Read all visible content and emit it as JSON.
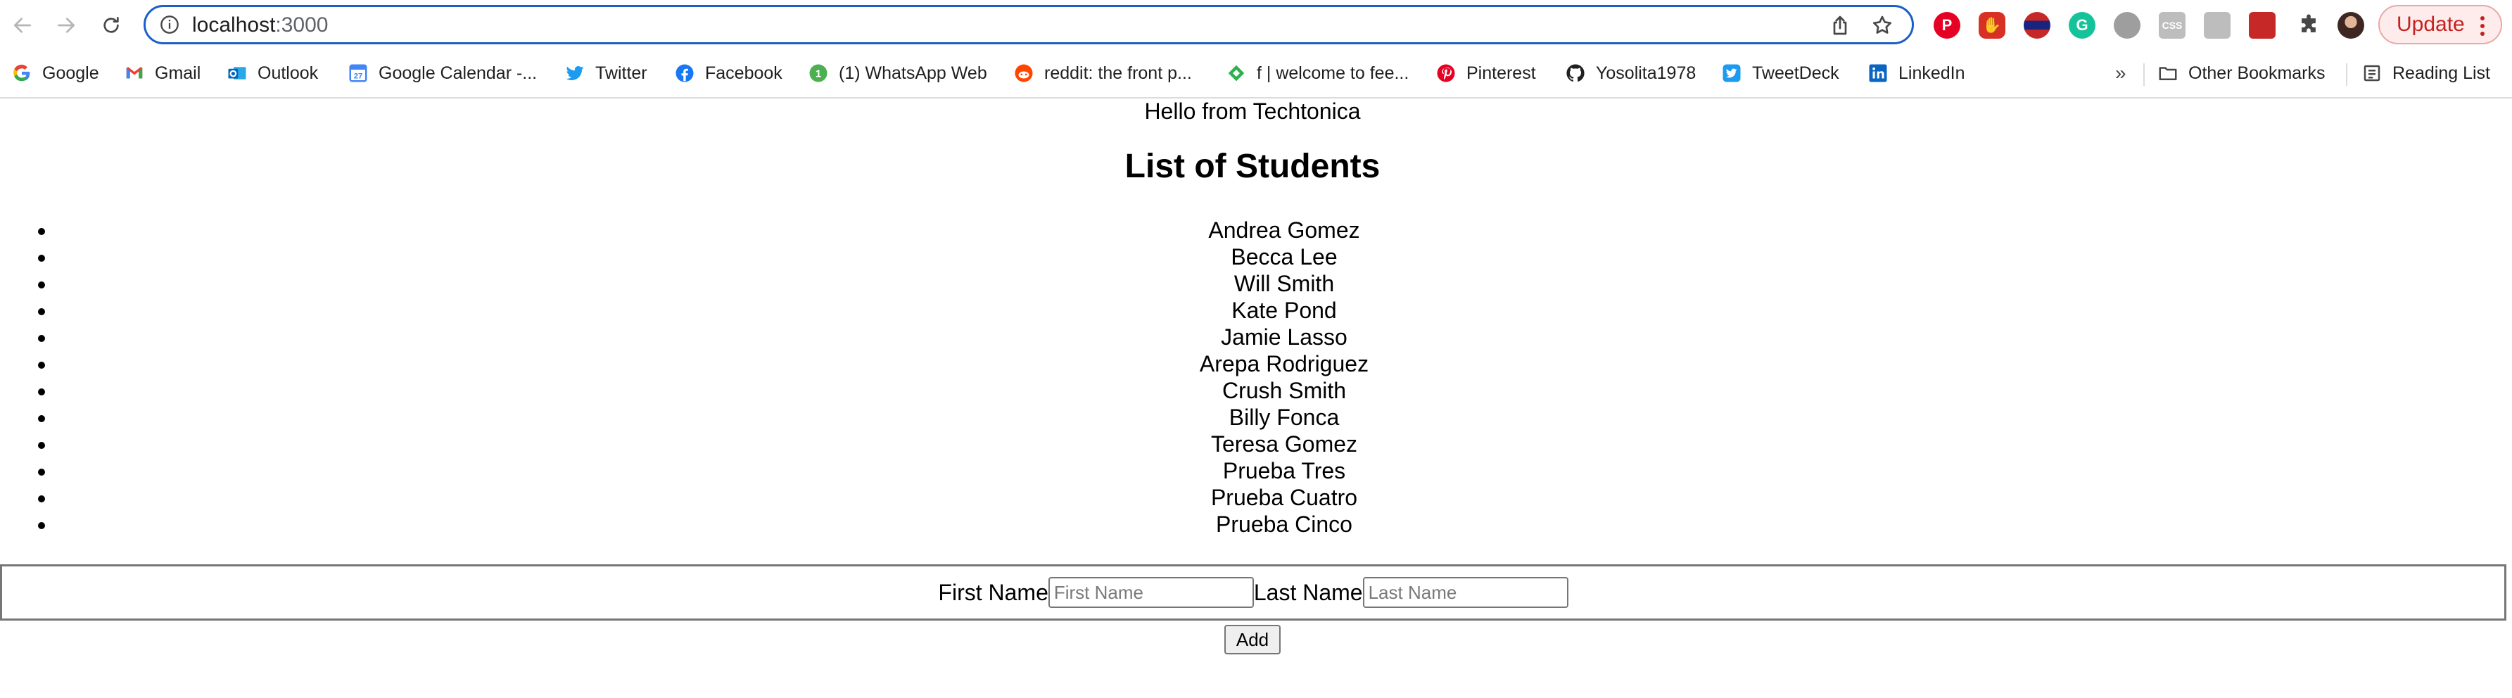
{
  "browser": {
    "url_host": "localhost",
    "url_port": ":3000",
    "update_label": "Update",
    "overflow_chevron": "»"
  },
  "bookmarks": [
    {
      "label": "Google",
      "icon": "google-icon"
    },
    {
      "label": "Gmail",
      "icon": "gmail-icon"
    },
    {
      "label": "Outlook",
      "icon": "outlook-icon"
    },
    {
      "label": "Google Calendar -...",
      "icon": "calendar-icon"
    },
    {
      "label": "Twitter",
      "icon": "twitter-icon"
    },
    {
      "label": "Facebook",
      "icon": "facebook-icon"
    },
    {
      "label": "(1) WhatsApp Web",
      "icon": "whatsapp-icon"
    },
    {
      "label": "reddit: the front p...",
      "icon": "reddit-icon"
    },
    {
      "label": "f | welcome to fee...",
      "icon": "feedly-icon"
    },
    {
      "label": "Pinterest",
      "icon": "pinterest-icon"
    },
    {
      "label": "Yosolita1978",
      "icon": "github-icon"
    },
    {
      "label": "TweetDeck",
      "icon": "tweetdeck-icon"
    },
    {
      "label": "LinkedIn",
      "icon": "linkedin-icon"
    }
  ],
  "bookmarks_right": {
    "other": "Other Bookmarks",
    "reading": "Reading List"
  },
  "page": {
    "greeting": "Hello from Techtonica",
    "heading": "List of Students",
    "students": [
      "Andrea Gomez",
      "Becca Lee",
      "Will Smith",
      "Kate Pond",
      "Jamie Lasso",
      "Arepa Rodriguez",
      "Crush Smith",
      "Billy Fonca",
      "Teresa Gomez",
      "Prueba Tres",
      "Prueba Cuatro",
      "Prueba Cinco"
    ],
    "form": {
      "first_label": "First Name",
      "first_placeholder": "First Name",
      "last_label": "Last Name",
      "last_placeholder": "Last Name",
      "add_label": "Add"
    }
  },
  "colors": {
    "omnibox_border": "#1a5fc8",
    "update_text": "#c5221f",
    "update_bg": "#fdeceb"
  }
}
